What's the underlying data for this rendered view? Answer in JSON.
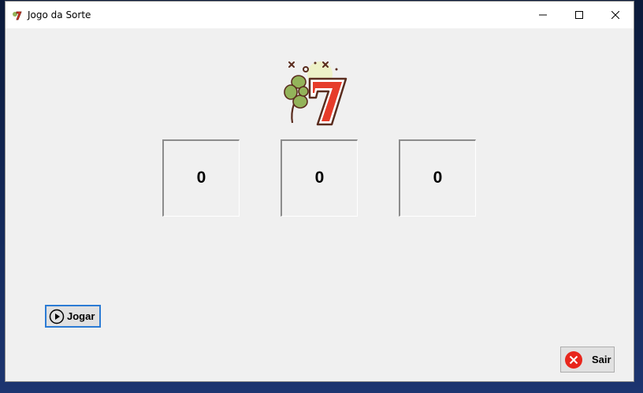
{
  "window": {
    "title": "Jogo da Sorte"
  },
  "slots": [
    "0",
    "0",
    "0"
  ],
  "buttons": {
    "play_label": "Jogar",
    "exit_label": "Sair"
  },
  "colors": {
    "focus_border": "#2b7bd4",
    "exit_icon": "#e8261c",
    "seven": "#e63c2a",
    "clover": "#93b35a"
  },
  "icons": {
    "app": "lucky-seven-icon",
    "play": "play-circle-icon",
    "exit": "close-circle-icon"
  }
}
